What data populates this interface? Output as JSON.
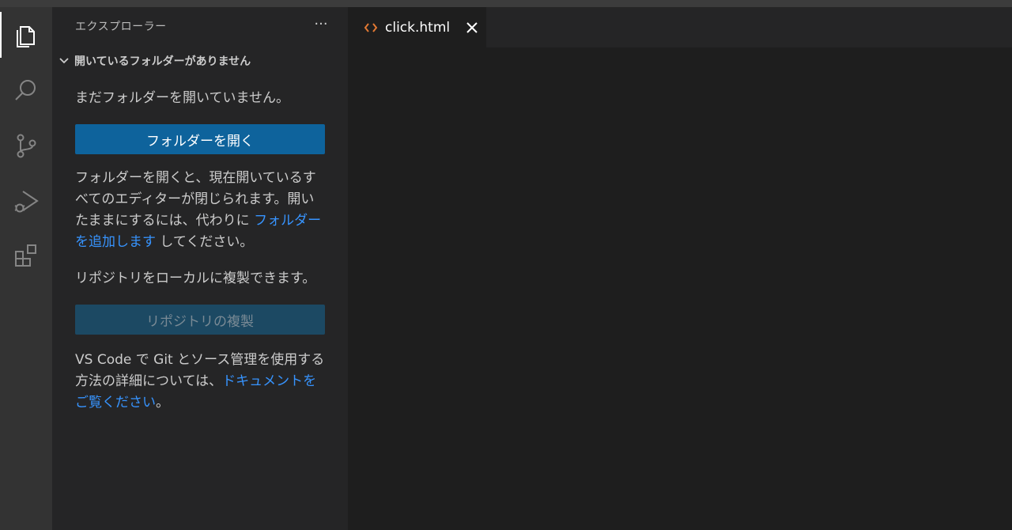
{
  "activity_bar": {
    "items": [
      {
        "name": "explorer",
        "icon": "files-icon",
        "active": true
      },
      {
        "name": "search",
        "icon": "search-icon",
        "active": false
      },
      {
        "name": "source-control",
        "icon": "source-control-icon",
        "active": false
      },
      {
        "name": "run-debug",
        "icon": "run-debug-icon",
        "active": false
      },
      {
        "name": "extensions",
        "icon": "extensions-icon",
        "active": false
      }
    ]
  },
  "sidebar": {
    "title": "エクスプローラー",
    "more_label": "···",
    "section_title": "開いているフォルダーがありません",
    "no_folder_text": "まだフォルダーを開いていません。",
    "open_folder_button": "フォルダーを開く",
    "info_text_before": "フォルダーを開くと、現在開いているすべてのエディターが閉じられます。開いたままにするには、代わりに ",
    "info_link": "フォルダーを追加します",
    "info_text_after": " してください。",
    "clone_text": "リポジトリをローカルに複製できます。",
    "clone_button": "リポジトリの複製",
    "git_text_before": "VS Code で Git とソース管理を使用する方法の詳細については、",
    "git_link": "ドキュメントをご覧ください",
    "git_text_after": "。"
  },
  "editor": {
    "tabs": [
      {
        "label": "click.html",
        "icon": "html-code-icon",
        "active": true
      }
    ]
  },
  "colors": {
    "accent_button": "#0e639c",
    "link": "#3794ff",
    "html_icon": "#e37933"
  }
}
